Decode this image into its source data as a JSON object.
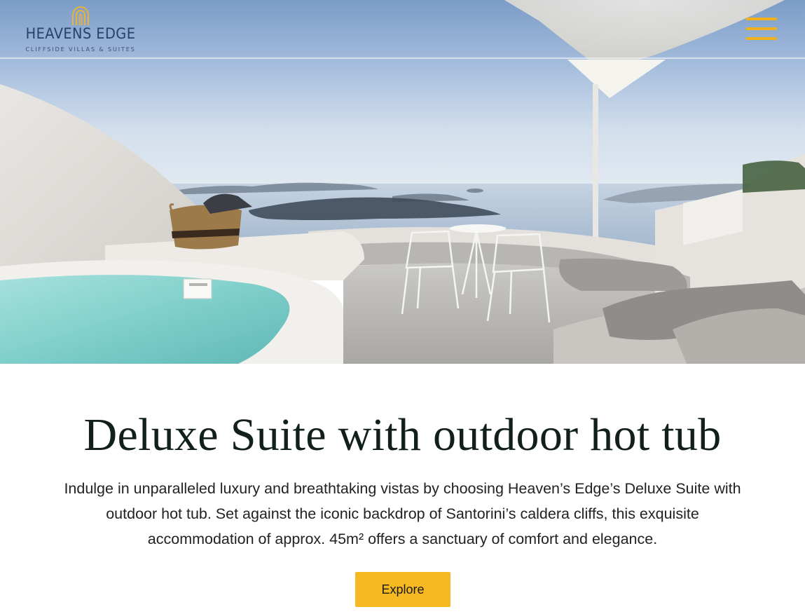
{
  "header": {
    "logo": {
      "name": "HEAVENS EDGE",
      "tagline": "CLIFFSIDE VILLAS & SUITES",
      "mark_icon": "arch-icon"
    },
    "menu_icon": "hamburger-menu-icon"
  },
  "hero": {
    "image": "suite-terrace-photo"
  },
  "main": {
    "title": "Deluxe Suite with outdoor hot tub",
    "description": "Indulge in unparalleled luxury and breathtaking vistas by choosing Heaven’s Edge’s Deluxe Suite with outdoor hot tub. Set against the iconic backdrop of Santorini’s caldera cliffs, this exquisite accommodation of approx. 45m² offers a sanctuary of comfort and elegance.",
    "explore_label": "Explore"
  },
  "colors": {
    "accent": "#f6b921",
    "logo_gold": "#e9b33a",
    "logo_navy": "#29406a",
    "title": "#111f1d"
  }
}
